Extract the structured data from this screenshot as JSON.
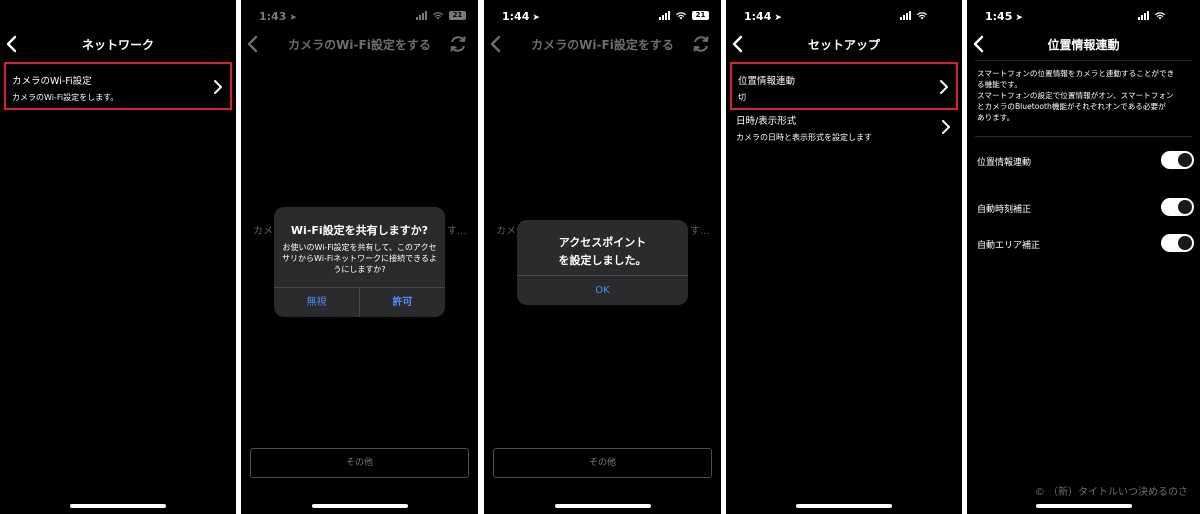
{
  "screens": [
    {
      "title": "ネットワーク",
      "items": [
        {
          "title": "カメラのWi-Fi設定",
          "subtitle": "カメラのWi-Fi設定をします。"
        }
      ]
    },
    {
      "time": "1:43",
      "battery": "21",
      "title": "カメラのWi-Fi設定をする",
      "background_text_left": "カメ",
      "background_text_right": "す...",
      "alert": {
        "title": "Wi-Fi設定を共有しますか?",
        "message": "お使いのWi-Fi設定を共有して、このアクセサリからWi-Fiネットワークに接続できるようにしますか?",
        "buttons": [
          "無視",
          "許可"
        ]
      },
      "other_button": "その他"
    },
    {
      "time": "1:44",
      "battery": "21",
      "title": "カメラのWi-Fi設定をする",
      "background_text_left": "カメ",
      "background_text_right": "す...",
      "alert": {
        "title_line1": "アクセスポイント",
        "title_line2": "を設定しました。",
        "button": "OK"
      },
      "other_button": "その他"
    },
    {
      "time": "1:44",
      "battery": "21",
      "title": "セットアップ",
      "items": [
        {
          "title": "位置情報連動",
          "subtitle": "切"
        },
        {
          "title": "日時/表示形式",
          "subtitle": "カメラの日時と表示形式を設定します"
        }
      ]
    },
    {
      "time": "1:45",
      "battery": "21",
      "title": "位置情報連動",
      "description_line1": "スマートフォンの位置情報をカメラと連動することができ",
      "description_line2": "る機能です。",
      "description_line3": "スマートフォンの設定で位置情報がオン、スマートフォン",
      "description_line4": "とカメラのBluetooth機能がそれぞれオンである必要が",
      "description_line5": "あります。",
      "toggles": [
        {
          "label": "位置情報連動",
          "on": true
        },
        {
          "label": "自動時刻補正",
          "on": true
        },
        {
          "label": "自動エリア補正",
          "on": true
        }
      ],
      "watermark": "© （新）タイトルいつ決めるのさ"
    }
  ],
  "colors": {
    "highlight": "#d9232e",
    "accent_blue": "#4f8ef7",
    "background": "#000000"
  }
}
